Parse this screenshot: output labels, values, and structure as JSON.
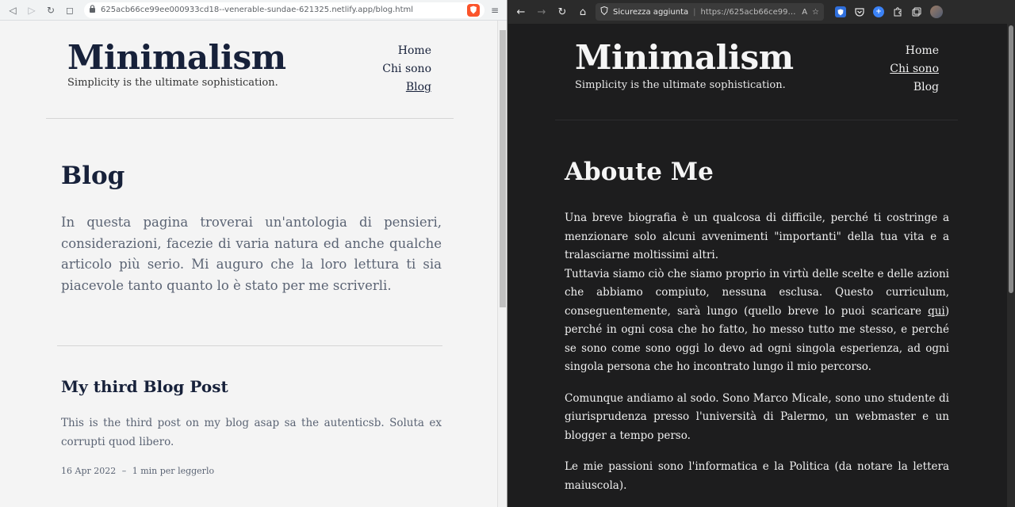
{
  "left_window": {
    "toolbar": {
      "url": "625acb66ce99ee000933cd18--venerable-sundae-621325.netlify.app/blog.html"
    },
    "site": {
      "brand": "Minimalism",
      "tagline": "Simplicity is the ultimate sophistication.",
      "nav": [
        "Home",
        "Chi sono",
        "Blog"
      ]
    },
    "page": {
      "title": "Blog",
      "intro": "In questa pagina troverai un'antologia di pensieri, considerazioni, facezie di varia natura ed anche qualche articolo più serio. Mi auguro che la loro lettura ti sia piacevole tanto quanto lo è stato per me scriverli."
    },
    "post": {
      "title": "My third Blog Post",
      "excerpt": "This is the third post on my blog asap sa the autenticsb. Soluta ex corrupti quod libero.",
      "date": "16 Apr 2022",
      "separator": "–",
      "reading_time": "1 min per leggerlo"
    }
  },
  "right_window": {
    "toolbar": {
      "security_label": "Sicurezza aggiunta",
      "url": "https://625acb66ce99ee000..."
    },
    "site": {
      "brand": "Minimalism",
      "tagline": "Simplicity is the ultimate sophistication.",
      "nav": [
        "Home",
        "Chi sono",
        "Blog"
      ]
    },
    "page": {
      "title": "Aboute Me",
      "para1_a": "Una breve biografia è un qualcosa di difficile, perché ti costringe a menzionare solo alcuni avvenimenti \"importanti\" della tua vita e a tralasciarne moltissimi altri.",
      "para1_b": "Tuttavia siamo ciò che siamo proprio in virtù delle scelte e delle azioni che abbiamo compiuto, nessuna esclusa. Questo curriculum, conseguentemente, sarà lungo (quello breve lo puoi scaricare",
      "para1_link": "qui",
      "para1_c": ") perché in ogni cosa che ho fatto, ho messo tutto me stesso, e perché se sono come sono oggi lo devo ad ogni singola esperienza, ad ogni singola persona che ho incontrato lungo il mio percorso.",
      "para2": "Comunque andiamo al sodo. Sono Marco Micale, sono uno studente di giurisprudenza presso l'università di Palermo, un webmaster e un blogger a tempo perso.",
      "para3": "Le mie passioni sono l'informatica e la Politica (da notare la lettera maiuscola)."
    }
  },
  "icons": {
    "back": "◁",
    "forward": "▷",
    "reload": "↻",
    "bookmark": "◻",
    "lock": "🔒",
    "shield": "🛡",
    "menu": "≡",
    "back_dark": "←",
    "forward_dark": "→",
    "home": "⌂",
    "read_aloud": "A",
    "star": "☆"
  },
  "colors": {
    "brave_shield": "#fb542b",
    "ext_blue": "#2f6fdc",
    "ext_plus": "#3b82f6"
  }
}
